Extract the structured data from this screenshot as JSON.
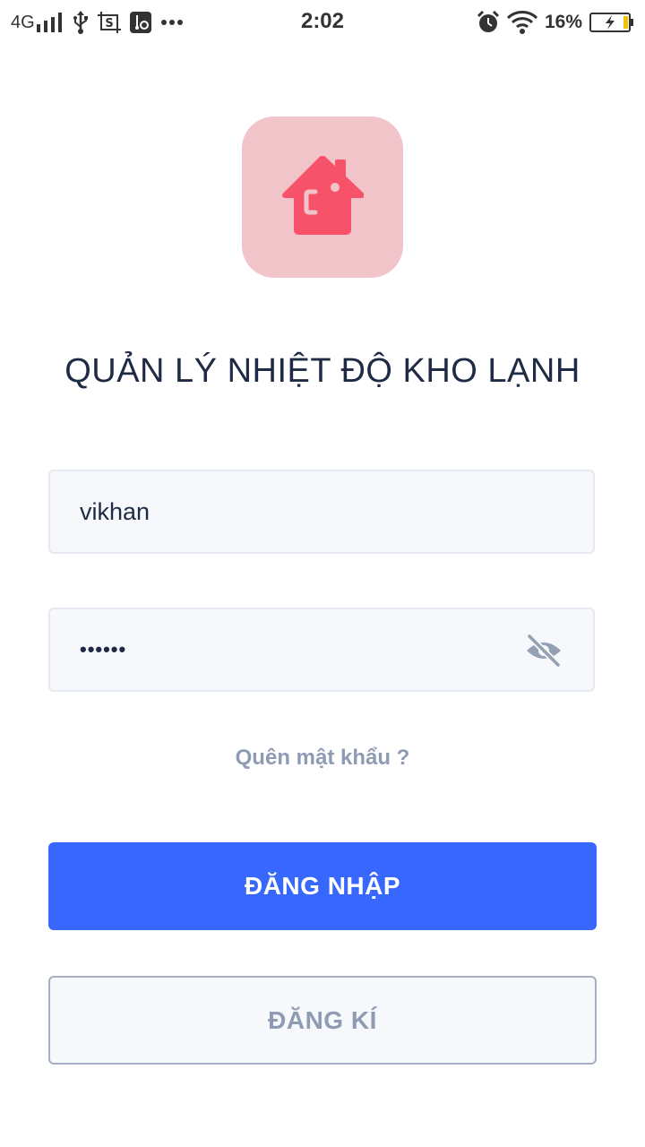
{
  "status_bar": {
    "network": "4G",
    "time": "2:02",
    "battery_percent": "16%",
    "icons": [
      "signal-icon",
      "usb-icon",
      "screenshot-icon",
      "usb-settings-icon",
      "more-dots-icon",
      "alarm-icon",
      "wifi-icon",
      "battery-charging-icon"
    ]
  },
  "app": {
    "title": "QUẢN LÝ NHIỆT ĐỘ KHO LẠNH",
    "logo_icon": "house-icon",
    "accent_color": "#3767fd",
    "logo_color": "#f6536a",
    "logo_bg": "#f1c4c9"
  },
  "form": {
    "username_value": "vikhan",
    "password_value": "••••••",
    "password_toggle_icon": "eye-off-icon",
    "forgot_label": "Quên mật khẩu ?",
    "login_label": "ĐĂNG NHẬP",
    "register_label": "ĐĂNG KÍ"
  }
}
